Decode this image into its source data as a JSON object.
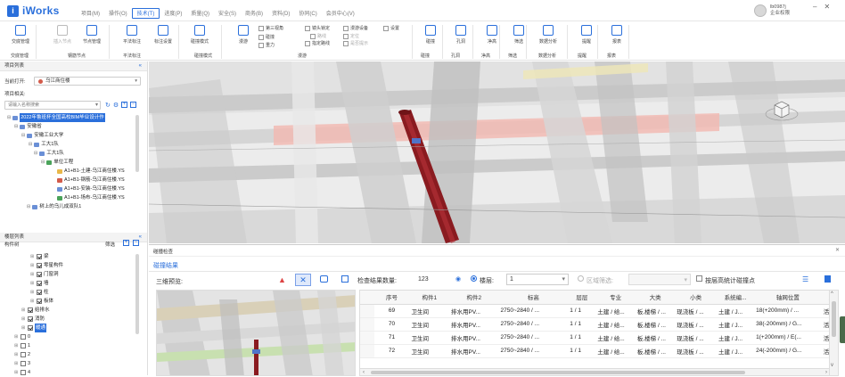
{
  "app": {
    "name": "iWorks"
  },
  "menus": [
    "项目(M)",
    "操作(O)",
    "技术(T)",
    "进度(P)",
    "质量(Q)",
    "安全(S)",
    "商务(B)",
    "资料(D)",
    "协同(C)",
    "会员中心(V)"
  ],
  "active_menu": "技术(T)",
  "user": {
    "name": "lb0987j",
    "role": "企业权限"
  },
  "ribbon": {
    "buttons": [
      {
        "label": "交底管理"
      },
      {
        "label": "插入节点"
      },
      {
        "label": "节点管理"
      },
      {
        "label": "平法标注"
      },
      {
        "label": "标注设置"
      },
      {
        "label": "碰撞模式"
      },
      {
        "label": "漫游"
      },
      {
        "label": "碰撞"
      },
      {
        "label": "孔洞"
      },
      {
        "label": "净高"
      },
      {
        "label": "筛选"
      },
      {
        "label": "数据分析"
      },
      {
        "label": "提醒"
      },
      {
        "label": "报表"
      }
    ],
    "groups": [
      "交底管理",
      "钢筋节点",
      "平法标注",
      "碰撞模式",
      "漫游",
      "碰撞",
      "孔洞",
      "净高",
      "筛选",
      "数据分析",
      "提醒",
      "报表"
    ],
    "smalls": [
      "第三视角",
      "碰撞",
      "重力",
      "镜头锁定",
      "路线",
      "指定路线",
      "漫游设备",
      "定位",
      "是否提示",
      "设置"
    ]
  },
  "left": {
    "project_list_title": "项目列表",
    "current_open_label": "当前打开:",
    "current_open_value": "乌江商住楼",
    "related_label": "项目相关:",
    "search_placeholder": "请输入名称搜索",
    "tree": [
      "2022年鲁班杯全国高校BIM毕业设计作",
      "安徽省",
      "安徽工业大学",
      "工大1队",
      "工大1队",
      "单位工程",
      "A1+B1-土建-乌江商住楼.YS",
      "A1+B1-钢筋-乌江商住楼.YS",
      "A1+B1-安装-乌江商住楼.YS",
      "A1+B1-场布-乌江商住楼.YS",
      "树上的乌儿成双队1"
    ],
    "floor_list_title": "楼层列表",
    "component_tree_title": "构件树",
    "filter_label": "筛选",
    "components": [
      "梁",
      "零星构件",
      "门窗洞",
      "墙",
      "柱",
      "板体",
      "给排水",
      "消防",
      "暖通",
      "0",
      "1",
      "2",
      "3",
      "4"
    ]
  },
  "bottom": {
    "panel_title": "碰撞检查",
    "tab": "碰撞结果",
    "preview_label": "三维预览:",
    "count_label": "检查结果数量:",
    "count": "123",
    "floor_label": "楼层:",
    "floor_value": "1",
    "region_filter_label": "区域筛选:",
    "floor_height_label": "按层高统计碰撞点",
    "columns": [
      "序号",
      "构件1",
      "构件2",
      "标高",
      "层层",
      "专业",
      "大类",
      "小类",
      "系统编...",
      "轴网位置",
      "处"
    ],
    "rows": [
      [
        "69",
        "卫生间",
        "排水用PV...",
        "2750~2840 / ...",
        "1 / 1",
        "土建 / 给...",
        "板,楼梯 / ...",
        "现浇板 / ...",
        "土建 / J...",
        "18(+200mm) / ...",
        "活"
      ],
      [
        "70",
        "卫生间",
        "排水用PV...",
        "2750~2840 / ...",
        "1 / 1",
        "土建 / 给...",
        "板,楼梯 / ...",
        "现浇板 / ...",
        "土建 / J...",
        "38(-200mm) / G...",
        "活"
      ],
      [
        "71",
        "卫生间",
        "排水用PV...",
        "2750~2840 / ...",
        "1 / 1",
        "土建 / 给...",
        "板,楼梯 / ...",
        "现浇板 / ...",
        "土建 / J...",
        "1(+200mm) / E(...",
        "活"
      ],
      [
        "72",
        "卫生间",
        "排水用PV...",
        "2750~2840 / ...",
        "1 / 1",
        "土建 / 给...",
        "板,楼梯 / ...",
        "现浇板 / ...",
        "土建 / J...",
        "24(-200mm) / G...",
        "活"
      ]
    ]
  }
}
